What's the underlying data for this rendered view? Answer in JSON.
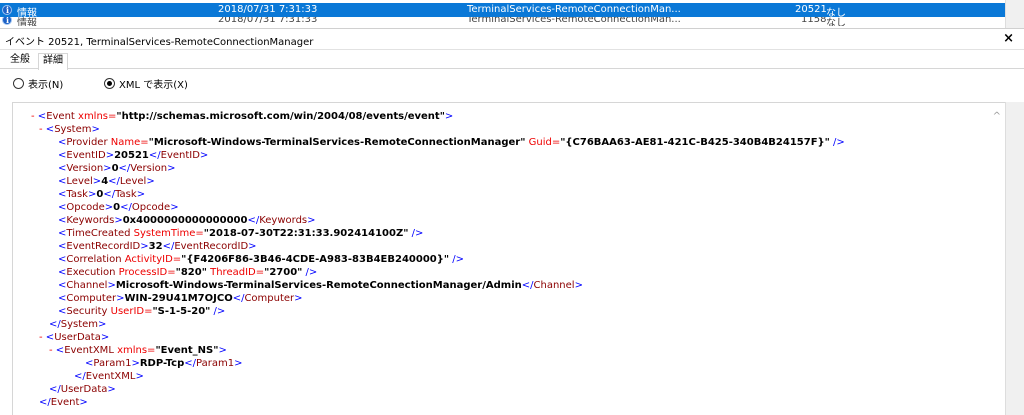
{
  "rows": [
    {
      "level": "情報",
      "date": "2018/07/31 7:31:33",
      "source": "TerminalServices-RemoteConnectionMan...",
      "id": "20521",
      "task": "なし"
    },
    {
      "level": "情報",
      "date": "2018/07/31 7:31:33",
      "source": "TerminalServices-RemoteConnectionMan...",
      "id": "1158",
      "task": "なし"
    }
  ],
  "header": {
    "title": "イベント 20521, TerminalServices-RemoteConnectionManager",
    "close": "×"
  },
  "tabs": [
    "全般",
    "詳細"
  ],
  "radios": {
    "general": "表示(N)",
    "xml": "XML で表示(X)"
  },
  "xml": {
    "l01": {
      "m": "- ",
      "b1": "<",
      "t": "Event",
      "a": " xmlns=",
      "v": "\"http://schemas.microsoft.com/win/2004/08/events/event\"",
      "b2": ">"
    },
    "l02": {
      "m": "- ",
      "b1": "<",
      "t": "System",
      "b2": ">"
    },
    "l03": {
      "b1": "<",
      "t": "Provider",
      "a1": " Name=",
      "v1": "\"Microsoft-Windows-TerminalServices-RemoteConnectionManager\"",
      "a2": " Guid=",
      "v2": "\"{C76BAA63-AE81-421C-B425-340B4B24157F}\"",
      "b2": " />"
    },
    "l04": {
      "b1": "<",
      "t1": "EventID",
      "b2": ">",
      "v": "20521",
      "b3": "</",
      "t2": "EventID",
      "b4": ">"
    },
    "l05": {
      "b1": "<",
      "t1": "Version",
      "b2": ">",
      "v": "0",
      "b3": "</",
      "t2": "Version",
      "b4": ">"
    },
    "l06": {
      "b1": "<",
      "t1": "Level",
      "b2": ">",
      "v": "4",
      "b3": "</",
      "t2": "Level",
      "b4": ">"
    },
    "l07": {
      "b1": "<",
      "t1": "Task",
      "b2": ">",
      "v": "0",
      "b3": "</",
      "t2": "Task",
      "b4": ">"
    },
    "l08": {
      "b1": "<",
      "t1": "Opcode",
      "b2": ">",
      "v": "0",
      "b3": "</",
      "t2": "Opcode",
      "b4": ">"
    },
    "l09": {
      "b1": "<",
      "t1": "Keywords",
      "b2": ">",
      "v": "0x4000000000000000",
      "b3": "</",
      "t2": "Keywords",
      "b4": ">"
    },
    "l10": {
      "b1": "<",
      "t": "TimeCreated",
      "a": " SystemTime=",
      "v": "\"2018-07-30T22:31:33.902414100Z\"",
      "b2": " />"
    },
    "l11": {
      "b1": "<",
      "t1": "EventRecordID",
      "b2": ">",
      "v": "32",
      "b3": "</",
      "t2": "EventRecordID",
      "b4": ">"
    },
    "l12": {
      "b1": "<",
      "t": "Correlation",
      "a": " ActivityID=",
      "v": "\"{F4206F86-3B46-4CDE-A983-83B4EB240000}\"",
      "b2": " />"
    },
    "l13": {
      "b1": "<",
      "t": "Execution",
      "a1": " ProcessID=",
      "v1": "\"820\"",
      "a2": " ThreadID=",
      "v2": "\"2700\"",
      "b2": " />"
    },
    "l14": {
      "b1": "<",
      "t1": "Channel",
      "b2": ">",
      "v": "Microsoft-Windows-TerminalServices-RemoteConnectionManager/Admin",
      "b3": "</",
      "t2": "Channel",
      "b4": ">"
    },
    "l15": {
      "b1": "<",
      "t1": "Computer",
      "b2": ">",
      "v": "WIN-29U41M7OJCO",
      "b3": "</",
      "t2": "Computer",
      "b4": ">"
    },
    "l16": {
      "b1": "<",
      "t": "Security",
      "a": " UserID=",
      "v": "\"S-1-5-20\"",
      "b2": " />"
    },
    "l17": {
      "b1": "</",
      "t": "System",
      "b2": ">"
    },
    "l18": {
      "m": "- ",
      "b1": "<",
      "t": "UserData",
      "b2": ">"
    },
    "l19": {
      "m": "- ",
      "b1": "<",
      "t": "EventXML",
      "a": " xmlns=",
      "v": "\"Event_NS\"",
      "b2": ">"
    },
    "l20": {
      "b1": "<",
      "t1": "Param1",
      "b2": ">",
      "v": "RDP-Tcp",
      "b3": "</",
      "t2": "Param1",
      "b4": ">"
    },
    "l21": {
      "b1": "</",
      "t": "EventXML",
      "b2": ">"
    },
    "l22": {
      "b1": "</",
      "t": "UserData",
      "b2": ">"
    },
    "l23": {
      "b1": "</",
      "t": "Event",
      "b2": ">"
    }
  },
  "scroll_arrow": "^",
  "colors": {
    "selection": "#0a78d7",
    "xml_tag": "#8b0000",
    "xml_bracket": "#0000ff",
    "xml_attr": "#ee0000"
  }
}
